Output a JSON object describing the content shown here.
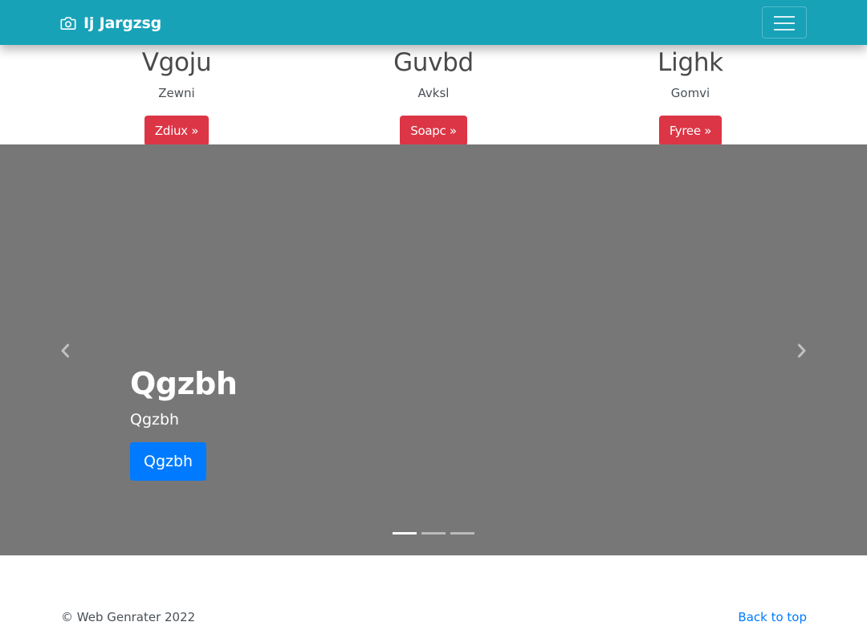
{
  "navbar": {
    "brand_icon": "camera-icon",
    "brand": "Ij Jargzsg",
    "toggler_icon": "hamburger-menu-icon",
    "color": "#17a2b8"
  },
  "features": [
    {
      "title": "Vgoju",
      "subtitle": "Zewni",
      "button": "Zdiux »"
    },
    {
      "title": "Guvbd",
      "subtitle": "Avksl",
      "button": "Soapc »"
    },
    {
      "title": "Lighk",
      "subtitle": "Gomvi",
      "button": "Fyree »"
    }
  ],
  "carousel": {
    "background": "#777777",
    "caption": {
      "title": "Qgzbh",
      "text": "Qgzbh",
      "button": "Qgzbh"
    },
    "prev_icon": "chevron-left-icon",
    "next_icon": "chevron-right-icon",
    "slide_count": 3,
    "active_slide": 1
  },
  "footer": {
    "copyright": "© Web Genrater 2022",
    "back_to_top": "Back to top"
  },
  "colors": {
    "danger": "#dc3545",
    "primary": "#007bff"
  }
}
